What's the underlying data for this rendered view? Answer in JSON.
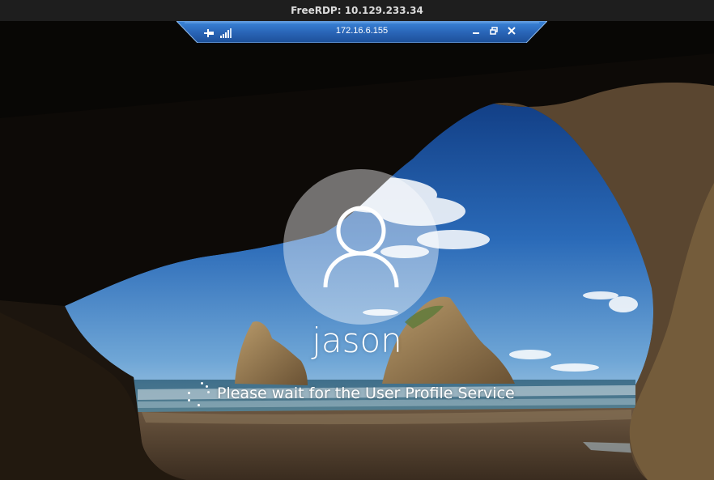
{
  "client_window": {
    "title": "FreeRDP: 10.129.233.34"
  },
  "rdp_connection_bar": {
    "host": "172.16.6.155",
    "pin_icon": "pin-icon",
    "signal_icon": "signal-bars-icon",
    "minimize_icon": "minimize-icon",
    "restore_icon": "restore-icon",
    "close_icon": "close-icon"
  },
  "lock_screen": {
    "username": "jason",
    "status_message": "Please wait for the User Profile Service",
    "avatar_icon": "user-silhouette-icon",
    "spinner_icon": "loading-dots-icon"
  },
  "colors": {
    "titlebar_bg": "#1e1e1e",
    "rdp_bar_blue": "#2c6fc4",
    "text": "#ffffff"
  }
}
